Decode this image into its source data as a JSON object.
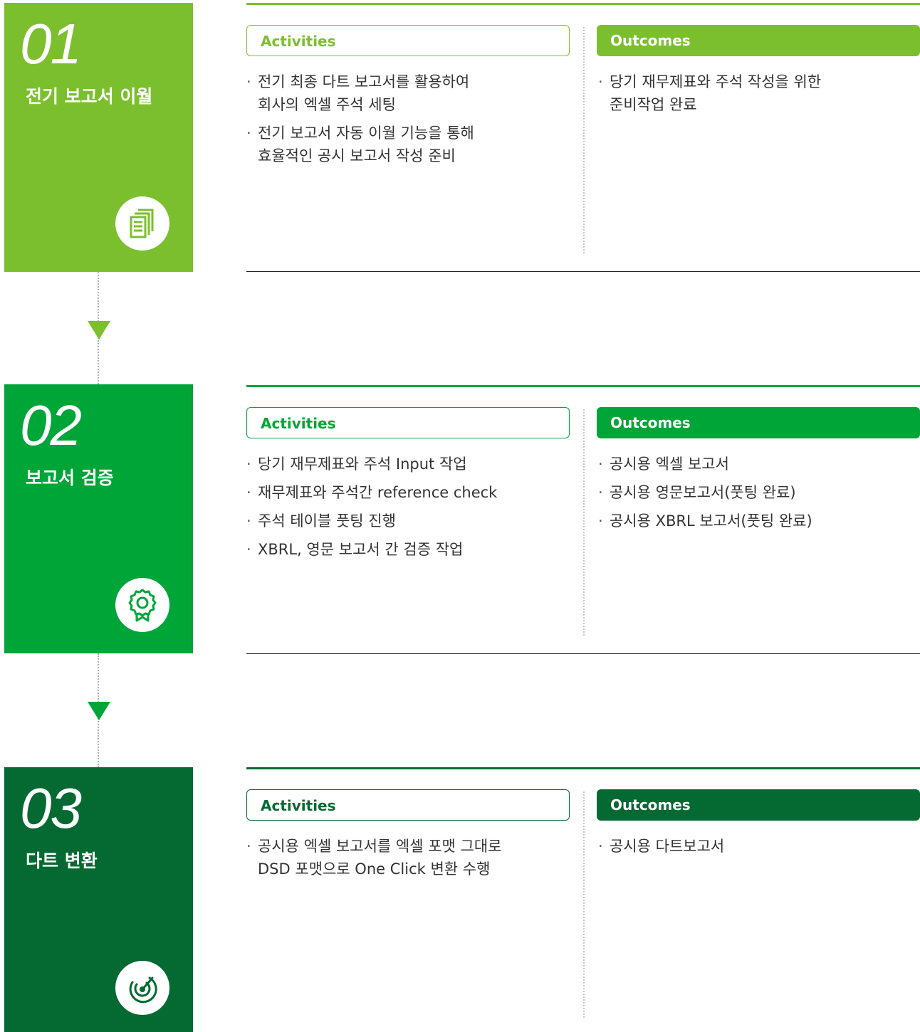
{
  "colors": {
    "step1": "#7cbf2e",
    "step2": "#00a538",
    "step3": "#046a31",
    "divider": "#222222",
    "text": "#333333"
  },
  "steps": [
    {
      "number": "01",
      "title": "전기 보고서 이월",
      "icon": "documents-icon",
      "activities_label": "Activities",
      "outcomes_label": "Outcomes",
      "activities": [
        "전기 최종 다트 보고서를 활용하여\n회사의 엑셀 주석 세팅",
        "전기 보고서 자동 이월 기능을 통해\n효율적인 공시 보고서 작성 준비"
      ],
      "outcomes": [
        "당기 재무제표와 주석 작성을 위한\n준비작업 완료"
      ]
    },
    {
      "number": "02",
      "title": "보고서 검증",
      "icon": "award-badge-icon",
      "activities_label": "Activities",
      "outcomes_label": "Outcomes",
      "activities": [
        "당기 재무제표와 주석 Input 작업",
        "재무제표와 주석간 reference check",
        "주석 테이블 풋팅 진행",
        "XBRL, 영문 보고서 간 검증 작업"
      ],
      "outcomes": [
        "공시용 엑셀 보고서",
        "공시용 영문보고서(풋팅 완료)",
        "공시용 XBRL 보고서(풋팅 완료)"
      ]
    },
    {
      "number": "03",
      "title": "다트 변환",
      "icon": "radar-signal-icon",
      "activities_label": "Activities",
      "outcomes_label": "Outcomes",
      "activities": [
        "공시용 엑셀 보고서를 엑셀 포맷 그대로\nDSD 포맷으로 One Click 변환 수행"
      ],
      "outcomes": [
        "공시용 다트보고서"
      ]
    }
  ],
  "bullet_symbol": "·"
}
